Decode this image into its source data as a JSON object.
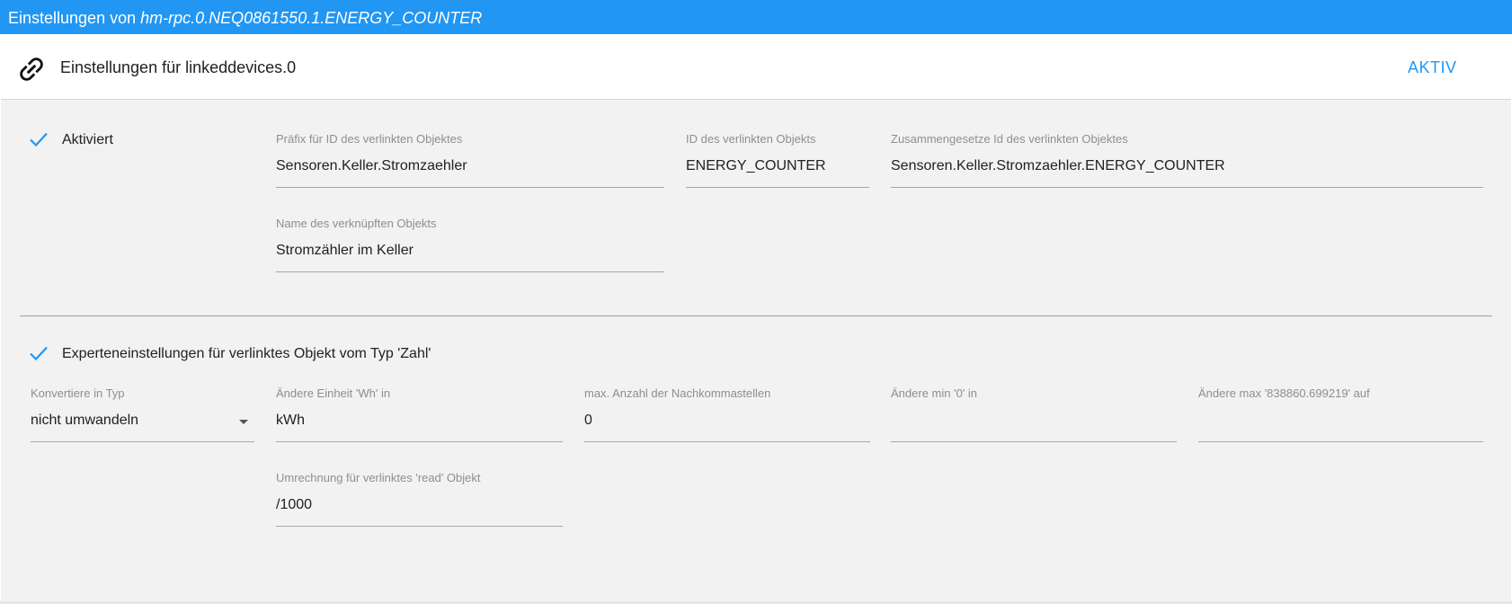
{
  "window": {
    "title_prefix": "Einstellungen von ",
    "object_id": "hm-rpc.0.NEQ0861550.1.ENERGY_COUNTER"
  },
  "header": {
    "icon": "link-icon",
    "title": "Einstellungen für linkeddevices.0",
    "status_button": "AKTIV"
  },
  "colors": {
    "accent": "#2196f3",
    "panel_background": "#f2f2f2"
  },
  "section_basic": {
    "enabled_label": "Aktiviert",
    "enabled_checked": true,
    "prefix_label": "Präfix für ID des verlinkten Objektes",
    "prefix_value": "Sensoren.Keller.Stromzaehler",
    "id_label": "ID des verlinkten Objekts",
    "id_value": "ENERGY_COUNTER",
    "composed_label": "Zusammengesetze Id des verlinkten Objektes",
    "composed_value": "Sensoren.Keller.Stromzaehler.ENERGY_COUNTER",
    "name_label": "Name des verknüpften Objekts",
    "name_value": "Stromzähler im Keller"
  },
  "section_expert": {
    "expert_label": "Experteneinstellungen für verlinktes Objekt vom Typ 'Zahl'",
    "expert_checked": true,
    "convert_label": "Konvertiere in Typ",
    "convert_value": "nicht umwandeln",
    "unit_label": "Ändere Einheit 'Wh' in",
    "unit_value": "kWh",
    "decimals_label": "max. Anzahl der Nachkommastellen",
    "decimals_value": "0",
    "min_label": "Ändere min '0' in",
    "min_value": "",
    "max_label": "Ändere max '838860.699219' auf",
    "max_value": "",
    "read_label": "Umrechnung für verlinktes 'read' Objekt",
    "read_value": "/1000"
  }
}
